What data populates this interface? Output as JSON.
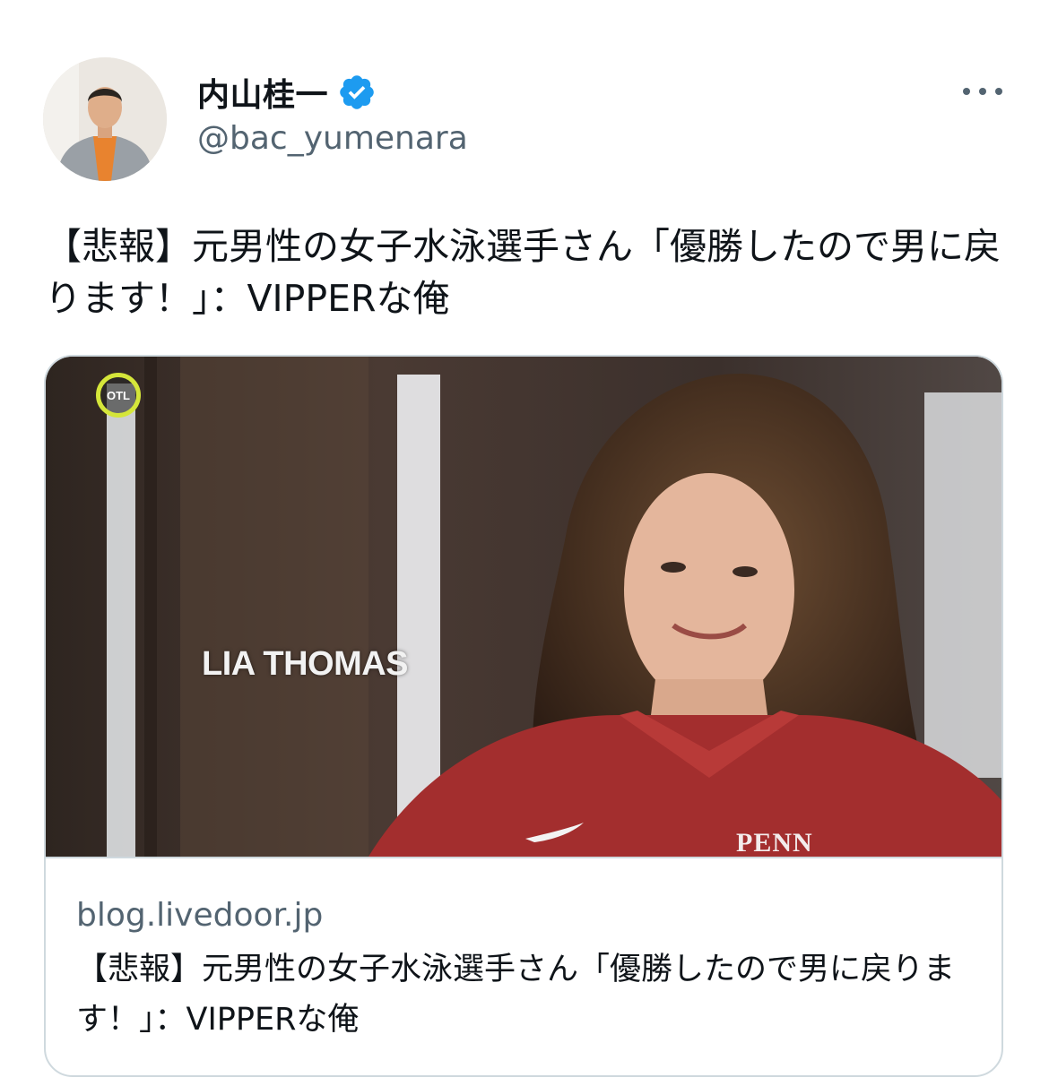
{
  "author": {
    "display_name": "内山桂一",
    "handle": "@bac_yumenara",
    "verified": true,
    "verified_color": "#1d9bf0"
  },
  "menu": {
    "icon": "more-horizontal-icon"
  },
  "tweet": {
    "text": "【悲報】元男性の女子水泳選手さん「優勝したので男に戻ります！」：VIPPERな俺"
  },
  "card": {
    "image_caption": "LIA THOMAS",
    "image_logo_text": "OTL",
    "image_shirt_text": "PENN",
    "domain": "blog.livedoor.jp",
    "title": "【悲報】元男性の女子水泳選手さん「優勝したので男に戻ります！」：VIPPERな俺"
  },
  "colors": {
    "text_primary": "#0f1419",
    "text_secondary": "#536471",
    "border": "#cfd9de"
  }
}
